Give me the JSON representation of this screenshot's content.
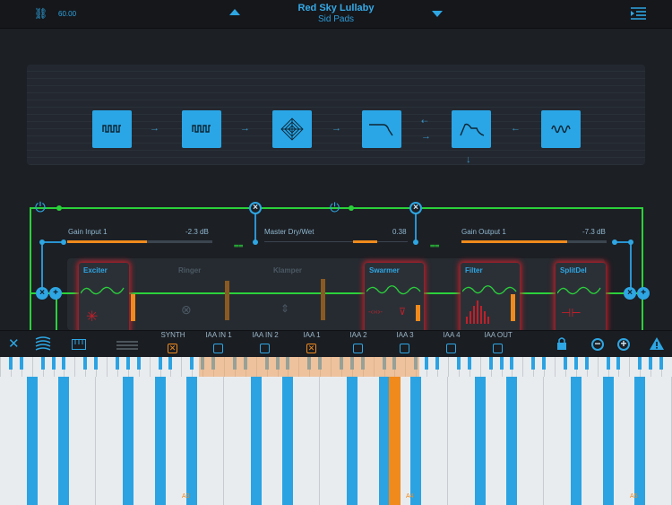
{
  "header": {
    "link_value": "60.00",
    "preset_name": "Red Sky Lullaby",
    "preset_bank": "Sid Pads"
  },
  "gains": {
    "input_label": "Gain Input 1",
    "input_value": "-2.3 dB",
    "input_level": 0.55,
    "drywet_label": "Master Dry/Wet",
    "drywet_value": "0.38",
    "drywet_level": 0.38,
    "output_label": "Gain Output 1",
    "output_value": "-7.3 dB",
    "output_level": 0.73
  },
  "effects": [
    {
      "name": "Exciter",
      "active": true
    },
    {
      "name": "Ringer",
      "active": false
    },
    {
      "name": "Klamper",
      "active": false
    },
    {
      "name": "Swarmer",
      "active": true
    },
    {
      "name": "Filter",
      "active": true
    },
    {
      "name": "SplitDel",
      "active": true
    }
  ],
  "toolbar": {
    "slots": [
      {
        "label": "SYNTH",
        "checked": true
      },
      {
        "label": "IAA IN 1",
        "checked": false
      },
      {
        "label": "IAA IN 2",
        "checked": false
      },
      {
        "label": "IAA 1",
        "checked": true
      },
      {
        "label": "IAA 2",
        "checked": false
      },
      {
        "label": "IAA 3",
        "checked": false
      },
      {
        "label": "IAA 4",
        "checked": false
      },
      {
        "label": "IAA OUT",
        "checked": false
      }
    ],
    "check_mark": "✕"
  },
  "keyboard": {
    "labels": [
      "A3",
      "A4",
      "A5"
    ],
    "active_note": "A4"
  },
  "colors": {
    "accent": "#2ea6e3",
    "orange": "#f08a1c",
    "green": "#2bd13b",
    "red": "#c0202a"
  }
}
